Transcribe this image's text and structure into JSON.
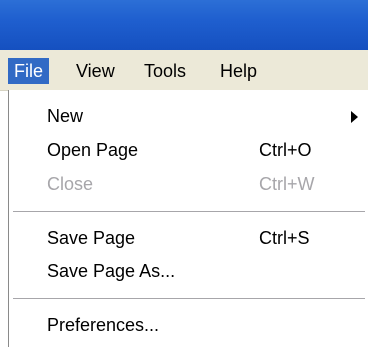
{
  "menubar": {
    "items": [
      {
        "label": "File",
        "active": true
      },
      {
        "label": "View"
      },
      {
        "label": "Tools"
      },
      {
        "label": "Help"
      }
    ]
  },
  "menu": {
    "items": [
      {
        "label": "New",
        "submenu": true,
        "icon": "submenu-arrow-icon"
      },
      {
        "label": "Open Page",
        "shortcut": "Ctrl+O"
      },
      {
        "label": "Close",
        "shortcut": "Ctrl+W",
        "disabled": true
      },
      {
        "label": "Save Page",
        "shortcut": "Ctrl+S"
      },
      {
        "label": "Save Page As..."
      },
      {
        "label": "Preferences..."
      }
    ]
  },
  "colors": {
    "titlebar": "#1f5fcf",
    "highlight": "#316ac5",
    "menubar_bg": "#ece9d8",
    "disabled_text": "#a7a6aa"
  }
}
